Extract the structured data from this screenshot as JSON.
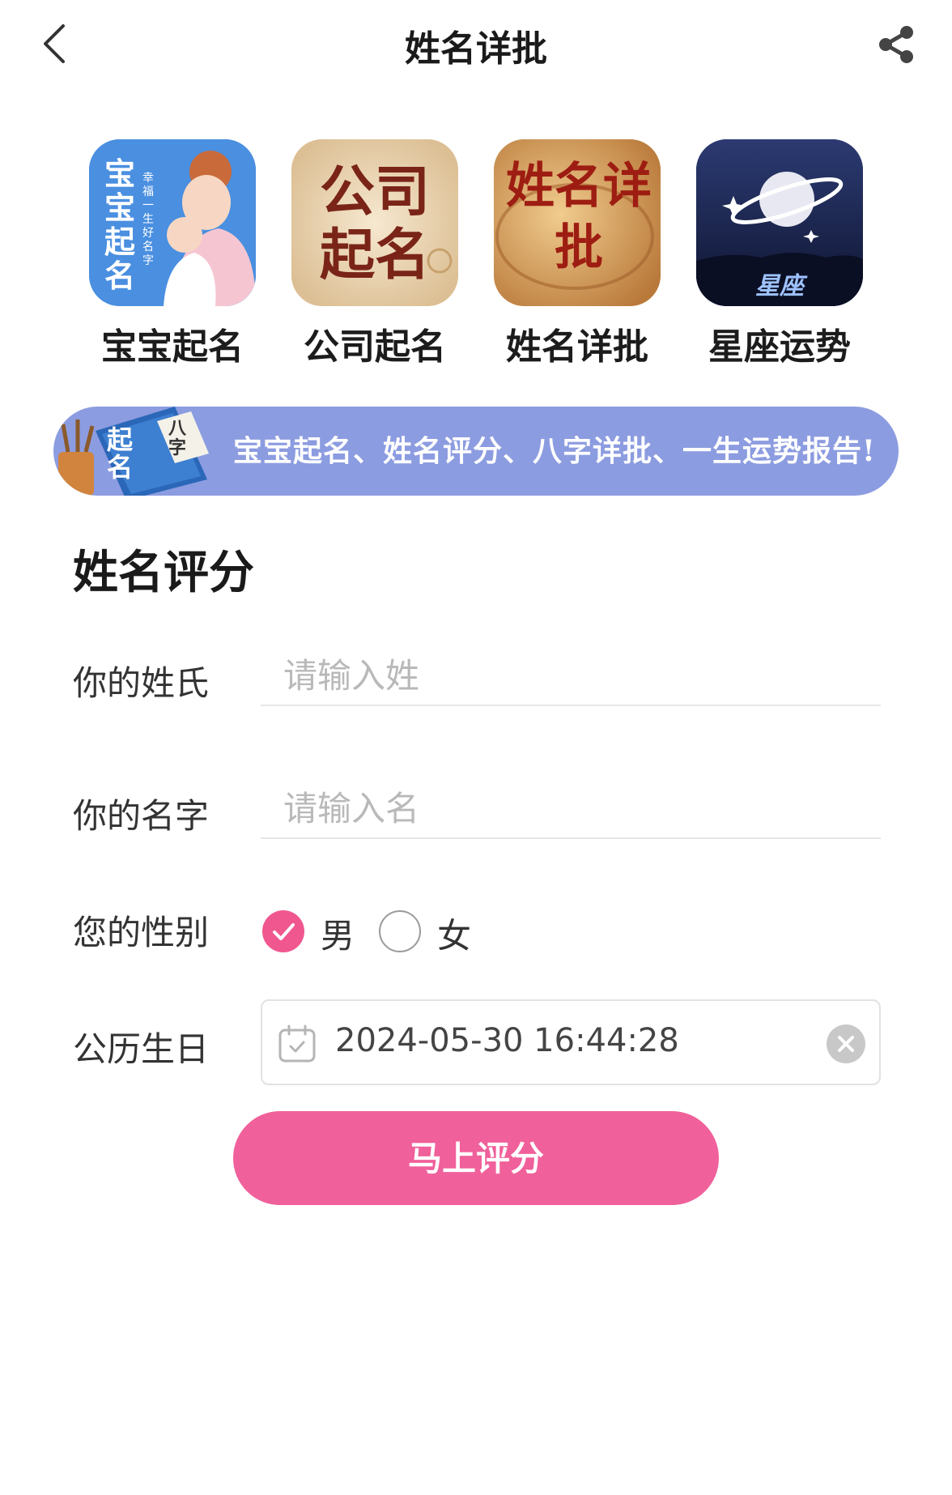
{
  "header": {
    "title": "姓名详批",
    "back_icon": "chevron-left-icon",
    "share_icon": "share-icon"
  },
  "apps": [
    {
      "label": "宝宝起名",
      "icon_text_main": "宝宝起名",
      "icon_text_sub": "幸福一生好名字",
      "color": "#4a90e2"
    },
    {
      "label": "公司起名",
      "icon_text_main": "公司起名",
      "color": "#e9d3b0"
    },
    {
      "label": "姓名详批",
      "icon_text_main": "姓名详批",
      "color": "#d7a25a"
    },
    {
      "label": "星座运势",
      "icon_text_main": "星座",
      "color": "#1d2a55"
    }
  ],
  "banner": {
    "text": "宝宝起名、姓名评分、八字详批、一生运势报告!",
    "art_text": "起名",
    "art_side_text": "八字",
    "color": "#8c9ce0"
  },
  "form": {
    "title": "姓名评分",
    "surname": {
      "label": "你的姓氏",
      "placeholder": "请输入姓",
      "value": ""
    },
    "given_name": {
      "label": "你的名字",
      "placeholder": "请输入名",
      "value": ""
    },
    "gender": {
      "label": "您的性别",
      "options": [
        "男",
        "女"
      ],
      "selected": "男"
    },
    "birthday": {
      "label": "公历生日",
      "value": "2024-05-30 16:44:28"
    },
    "submit_label": "马上评分"
  },
  "colors": {
    "accent": "#f0609a",
    "check": "#f0578f",
    "banner": "#8c9ce0"
  }
}
